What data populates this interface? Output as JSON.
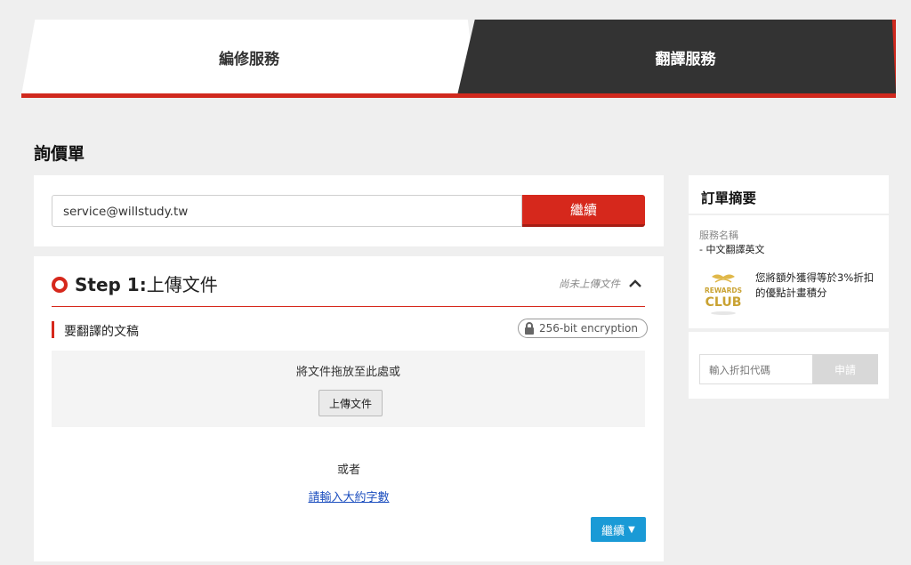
{
  "tabs": {
    "editing": "編修服務",
    "translation": "翻譯服務"
  },
  "page_title": "詢價單",
  "email": {
    "value": "service@willstudy.tw",
    "button": "繼續"
  },
  "step1": {
    "number": "Step 1:",
    "title": "上傳文件",
    "status": "尚未上傳文件",
    "doc_label": "要翻譯的文稿",
    "encryption": "256-bit encryption",
    "drop_text": "將文件拖放至此處或",
    "upload_button": "上傳文件",
    "or_text": "或者",
    "word_count_link": "請輸入大約字數",
    "continue_button": "繼續"
  },
  "summary": {
    "title": "訂單摘要",
    "service_label": "服務名稱",
    "service_value": "- 中文翻譯英文",
    "rewards_logo_top": "REWARDS",
    "rewards_logo_bottom": "CLUB",
    "rewards_text": "您將額外獲得等於3%折扣的優點計畫積分",
    "promo_placeholder": "輸入折扣代碼",
    "promo_button": "申請"
  },
  "colors": {
    "accent_red": "#d6281c",
    "dark_tab": "#333333",
    "continue_blue": "#1a9ad6",
    "rewards_gold": "#c9a232"
  }
}
